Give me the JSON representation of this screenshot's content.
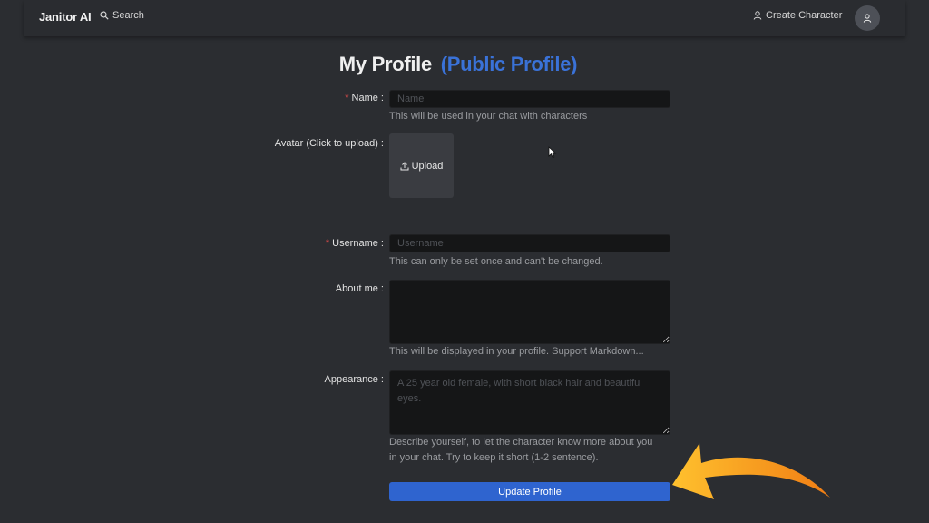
{
  "navbar": {
    "brand": "Janitor AI",
    "search_label": "Search",
    "create_label": "Create Character"
  },
  "page": {
    "title": "My Profile",
    "title_highlight": "(Public Profile)"
  },
  "form": {
    "name": {
      "required_mark": "*",
      "label": "Name",
      "placeholder": "Name",
      "help": "This will be used in your chat with characters"
    },
    "avatar": {
      "label": "Avatar (Click to upload)",
      "upload_label": "Upload"
    },
    "username": {
      "required_mark": "*",
      "label": "Username",
      "placeholder": "Username",
      "help": "This can only be set once and can't be changed."
    },
    "about": {
      "label": "About me",
      "placeholder": "",
      "help": "This will be displayed in your profile. Support Markdown..."
    },
    "appearance": {
      "label": "Appearance",
      "placeholder": "A 25 year old female, with short black hair and beautiful eyes.",
      "help_line1": "Describe yourself, to let the character know more about you",
      "help_line2": "in your chat. Try to keep it short (1-2 sentence)."
    },
    "submit_label": "Update Profile"
  },
  "colors": {
    "accent": "#2f64cf",
    "title_highlight": "#3a72d8",
    "required": "#e04b4b",
    "annotation_arrow": "#f39a1e"
  }
}
